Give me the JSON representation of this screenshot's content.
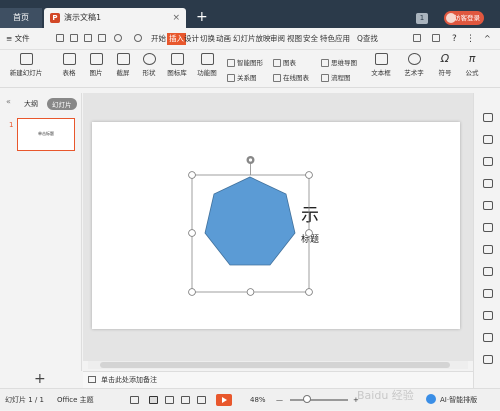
{
  "tabs": {
    "home": "首页",
    "doc": "演示文稿1",
    "doc_icon": "P",
    "close": "×",
    "add": "+"
  },
  "window": {
    "count": "1",
    "login": "访客登录"
  },
  "menu": {
    "file": "≡ 文件",
    "items": [
      "开始",
      "插入",
      "设计",
      "切换",
      "动画",
      "幻灯片放映",
      "审阅",
      "视图",
      "安全",
      "特色应用"
    ],
    "active": "插入",
    "search": "Q查找"
  },
  "ribbon": {
    "new_slide": "新建幻灯片",
    "table": "表格",
    "picture": "图片",
    "screenshot": "截屏",
    "shape": "形状",
    "icon_lib": "图标库",
    "function_chart": "功能图",
    "smart_graphic": "智能图形",
    "relation": "关系图",
    "chart": "图表",
    "online_chart": "在线图表",
    "mind_map": "思维导图",
    "flowchart": "流程图",
    "textbox": "文本框",
    "art_text": "艺术字",
    "symbol": "符号",
    "formula": "公式"
  },
  "left_panel": {
    "outline_tab": "大纲",
    "slides_tab": "幻灯片",
    "slide_number": "1",
    "thumb_text": "单击标题",
    "add": "+"
  },
  "slide": {
    "title_visible": "示",
    "subtitle_visible": "标题"
  },
  "notes": {
    "placeholder": "单击此处添加备注"
  },
  "status": {
    "slide_info": "幻灯片 1 / 1",
    "theme": "Office 主题",
    "zoom": "48%",
    "zoom_minus": "—",
    "zoom_plus": "+",
    "ai_label": "AI·智能排版",
    "watermark": "Baidu 经验"
  },
  "colors": {
    "accent": "#e8572c",
    "shape_fill": "#5b9bd5",
    "tabbar": "#2b3a4a"
  }
}
